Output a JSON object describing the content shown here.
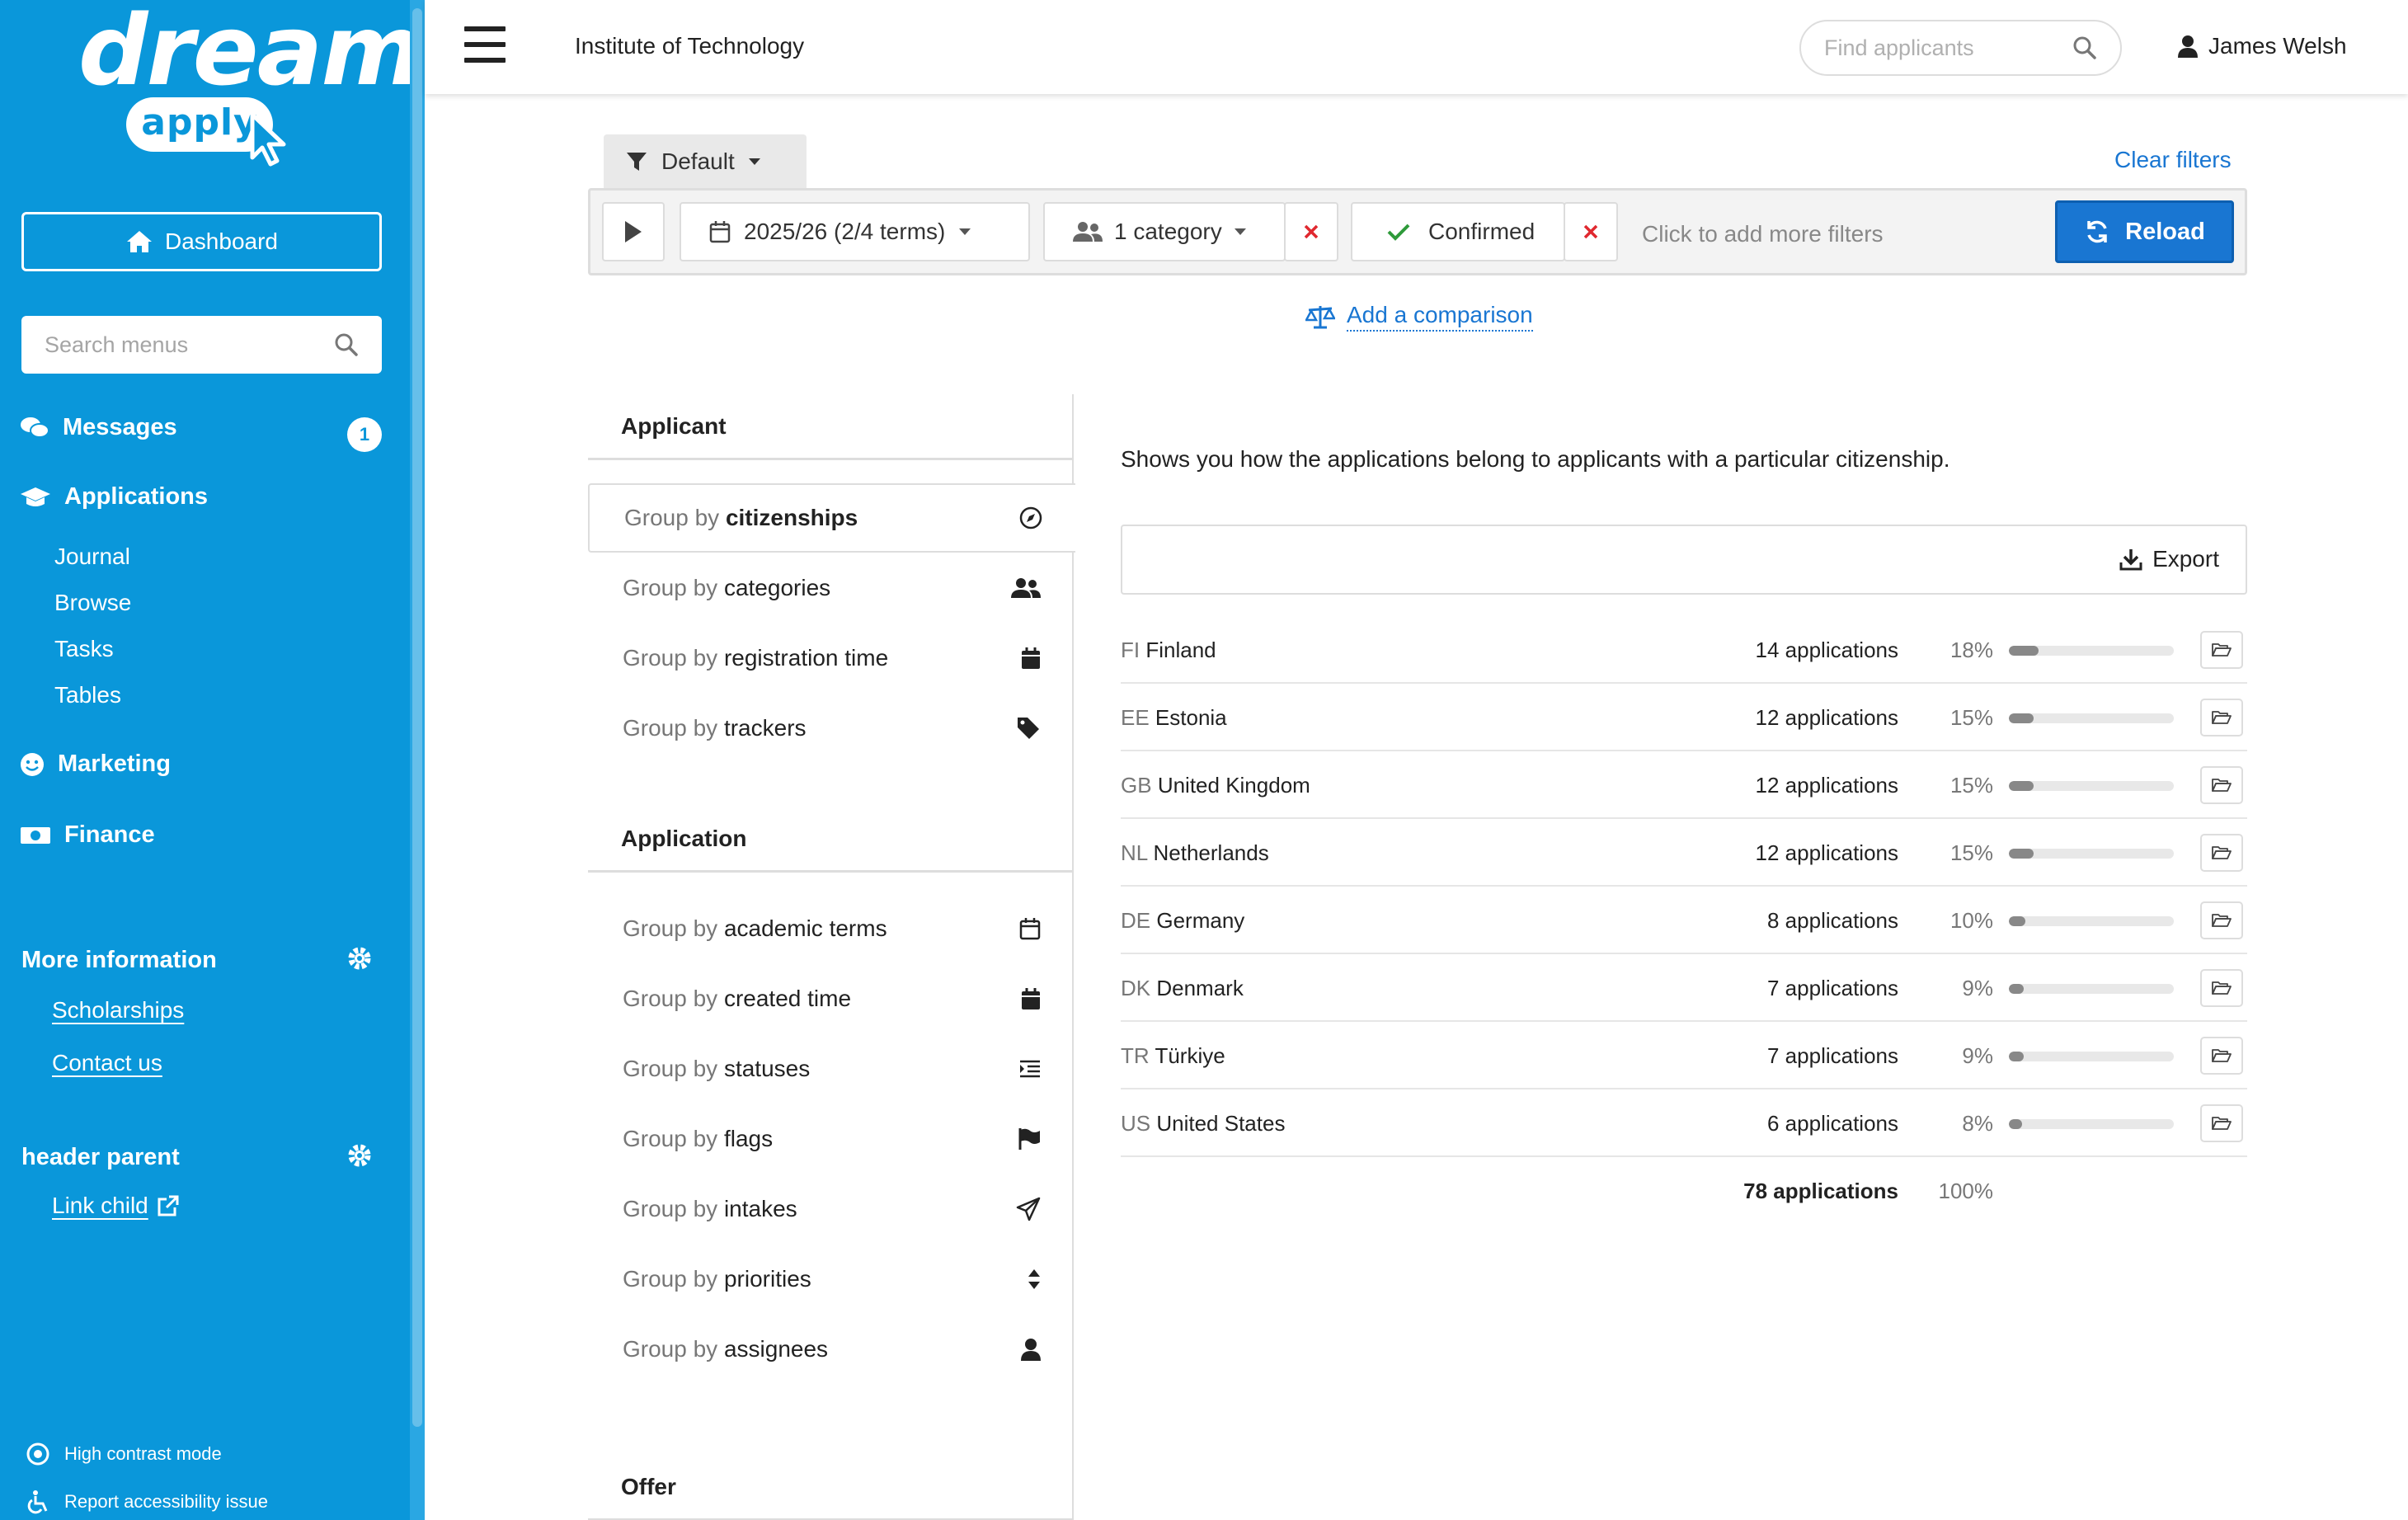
{
  "sidebar": {
    "logo": {
      "word1": "dream",
      "word2": "apply"
    },
    "dashboard_label": "Dashboard",
    "search_placeholder": "Search menus",
    "messages": {
      "label": "Messages",
      "badge": "1"
    },
    "applications_label": "Applications",
    "applications_items": [
      "Journal",
      "Browse",
      "Tasks",
      "Tables"
    ],
    "marketing_label": "Marketing",
    "finance_label": "Finance",
    "more_information": {
      "title": "More information",
      "links": [
        "Scholarships",
        "Contact us"
      ]
    },
    "header_parent": {
      "title": "header parent",
      "link": "Link child"
    },
    "accessibility": {
      "high_contrast": "High contrast mode",
      "report": "Report accessibility issue"
    }
  },
  "topbar": {
    "institution": "Institute of Technology",
    "find_placeholder": "Find applicants",
    "user": "James Welsh"
  },
  "filters": {
    "preset": "Default",
    "clear_label": "Clear filters",
    "term": "2025/26 (2/4 terms)",
    "category": "1 category",
    "status": "Confirmed",
    "add_more": "Click to add more filters",
    "reload_label": "Reload",
    "comparison_label": "Add a comparison"
  },
  "groups": {
    "applicant_title": "Applicant",
    "applicant_items": [
      {
        "prefix": "Group by",
        "name": "citizenships",
        "icon": "compass-icon",
        "active": true
      },
      {
        "prefix": "Group by",
        "name": "categories",
        "icon": "users-icon"
      },
      {
        "prefix": "Group by",
        "name": "registration time",
        "icon": "calendar-icon"
      },
      {
        "prefix": "Group by",
        "name": "trackers",
        "icon": "tag-icon"
      }
    ],
    "application_title": "Application",
    "application_items": [
      {
        "prefix": "Group by",
        "name": "academic terms",
        "icon": "calendar-outline-icon"
      },
      {
        "prefix": "Group by",
        "name": "created time",
        "icon": "calendar-icon"
      },
      {
        "prefix": "Group by",
        "name": "statuses",
        "icon": "list-indent-icon"
      },
      {
        "prefix": "Group by",
        "name": "flags",
        "icon": "flag-icon"
      },
      {
        "prefix": "Group by",
        "name": "intakes",
        "icon": "paper-plane-icon"
      },
      {
        "prefix": "Group by",
        "name": "priorities",
        "icon": "sort-icon"
      },
      {
        "prefix": "Group by",
        "name": "assignees",
        "icon": "user-icon"
      }
    ],
    "offer_title": "Offer"
  },
  "results": {
    "description": "Shows you how the applications belong to applicants with a particular citizenship.",
    "export_label": "Export",
    "rows": [
      {
        "code": "FI",
        "country": "Finland",
        "applications": "14 applications",
        "percent": "18%",
        "share": 0.18
      },
      {
        "code": "EE",
        "country": "Estonia",
        "applications": "12 applications",
        "percent": "15%",
        "share": 0.15
      },
      {
        "code": "GB",
        "country": "United Kingdom",
        "applications": "12 applications",
        "percent": "15%",
        "share": 0.15
      },
      {
        "code": "NL",
        "country": "Netherlands",
        "applications": "12 applications",
        "percent": "15%",
        "share": 0.15
      },
      {
        "code": "DE",
        "country": "Germany",
        "applications": "8 applications",
        "percent": "10%",
        "share": 0.1
      },
      {
        "code": "DK",
        "country": "Denmark",
        "applications": "7 applications",
        "percent": "9%",
        "share": 0.09
      },
      {
        "code": "TR",
        "country": "Türkiye",
        "applications": "7 applications",
        "percent": "9%",
        "share": 0.09
      },
      {
        "code": "US",
        "country": "United States",
        "applications": "6 applications",
        "percent": "8%",
        "share": 0.08
      }
    ],
    "total": {
      "applications": "78 applications",
      "percent": "100%"
    }
  },
  "colors": {
    "sidebar": "#0a97da",
    "accent": "#1976d2",
    "confirm": "#2e9a3a",
    "remove": "#e0282f"
  }
}
